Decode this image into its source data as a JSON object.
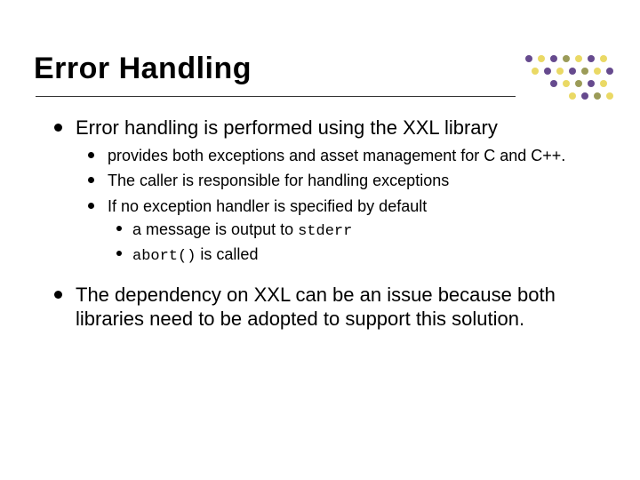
{
  "title": "Error Handling",
  "bullets": {
    "b1": "Error handling is performed using the XXL library",
    "b1_children": {
      "c1": "provides both exceptions and asset management for C and C++.",
      "c2": "The caller is responsible for handling exceptions",
      "c3": "If no exception handler is specified by default",
      "c3_children": {
        "d1_pre": "a message is output to ",
        "d1_code": "stderr",
        "d2_code": "abort()",
        "d2_post": " is called"
      }
    },
    "b2": "The dependency on XXL can be an issue because both libraries need to be adopted to support this solution."
  },
  "decor": {
    "colors": {
      "purple": "#4b2a7a",
      "yellow": "#e6d24a",
      "olive": "#8a8a3b"
    }
  }
}
